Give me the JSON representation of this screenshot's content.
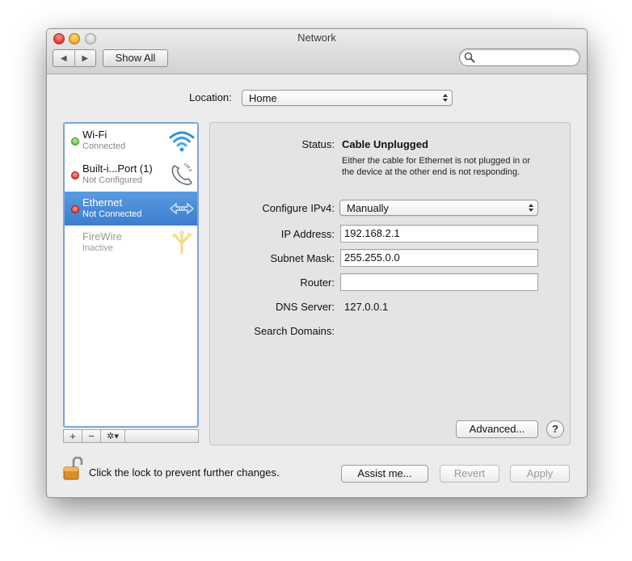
{
  "window": {
    "title": "Network"
  },
  "toolbar": {
    "back_icon": "back-arrow-icon",
    "forward_icon": "forward-arrow-icon",
    "back_glyph": "◀",
    "forward_glyph": "▶",
    "show_all_label": "Show All",
    "search_value": ""
  },
  "location": {
    "label": "Location:",
    "value": "Home"
  },
  "services": [
    {
      "name": "Wi-Fi",
      "status": "Connected",
      "dot": "green",
      "icon": "wifi-icon"
    },
    {
      "name": "Built-i...Port (1)",
      "status": "Not Configured",
      "dot": "red",
      "icon": "phone-modem-icon"
    },
    {
      "name": "Ethernet",
      "status": "Not Connected",
      "dot": "red",
      "icon": "ethernet-icon",
      "selected": true
    },
    {
      "name": "FireWire",
      "status": "Inactive",
      "dot": "none",
      "icon": "firewire-icon"
    }
  ],
  "sidebar_bar": {
    "add": "+",
    "remove": "−",
    "action": "✲▾"
  },
  "detail": {
    "status_label": "Status:",
    "status_value": "Cable Unplugged",
    "status_description": "Either the cable for Ethernet is not plugged in or the device at the other end is not responding.",
    "configure_label": "Configure IPv4:",
    "configure_value": "Manually",
    "ip_label": "IP Address:",
    "ip_value": "192.168.2.1",
    "subnet_label": "Subnet Mask:",
    "subnet_value": "255.255.0.0",
    "router_label": "Router:",
    "router_value": "",
    "dns_label": "DNS Server:",
    "dns_value": "127.0.0.1",
    "search_domains_label": "Search Domains:",
    "advanced_label": "Advanced...",
    "help_label": "?"
  },
  "footer": {
    "lock_text": "Click the lock to prevent further changes.",
    "assist_label": "Assist me...",
    "revert_label": "Revert",
    "apply_label": "Apply"
  },
  "colors": {
    "selection": "#3c7dcf",
    "sidebar_focus_ring": "#7ba6dc",
    "status_connected": "#4fb52a",
    "status_disconnected": "#d52016"
  }
}
